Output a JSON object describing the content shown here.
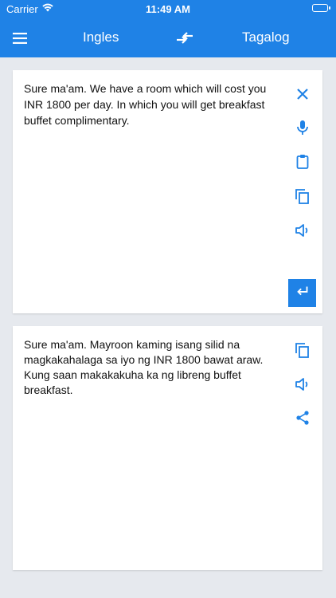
{
  "status_bar": {
    "carrier": "Carrier",
    "time": "11:49 AM"
  },
  "app_bar": {
    "source_language": "Ingles",
    "target_language": "Tagalog"
  },
  "source": {
    "text": "Sure ma'am. We have a room which will cost you INR 1800 per day. In which you will get breakfast buffet complimentary."
  },
  "target": {
    "text": "Sure ma'am. Mayroon kaming isang silid na magkakahalaga sa iyo ng INR 1800 bawat araw. Kung saan makakakuha ka ng libreng buffet breakfast."
  },
  "colors": {
    "primary": "#1f82e6",
    "background": "#e6e9ee"
  },
  "icons": {
    "menu": "menu-icon",
    "swap": "swap-icon",
    "clear": "close-icon",
    "mic": "mic-icon",
    "paste": "clipboard-icon",
    "copy": "copy-icon",
    "speak": "speaker-icon",
    "enter": "enter-icon",
    "share": "share-icon"
  }
}
